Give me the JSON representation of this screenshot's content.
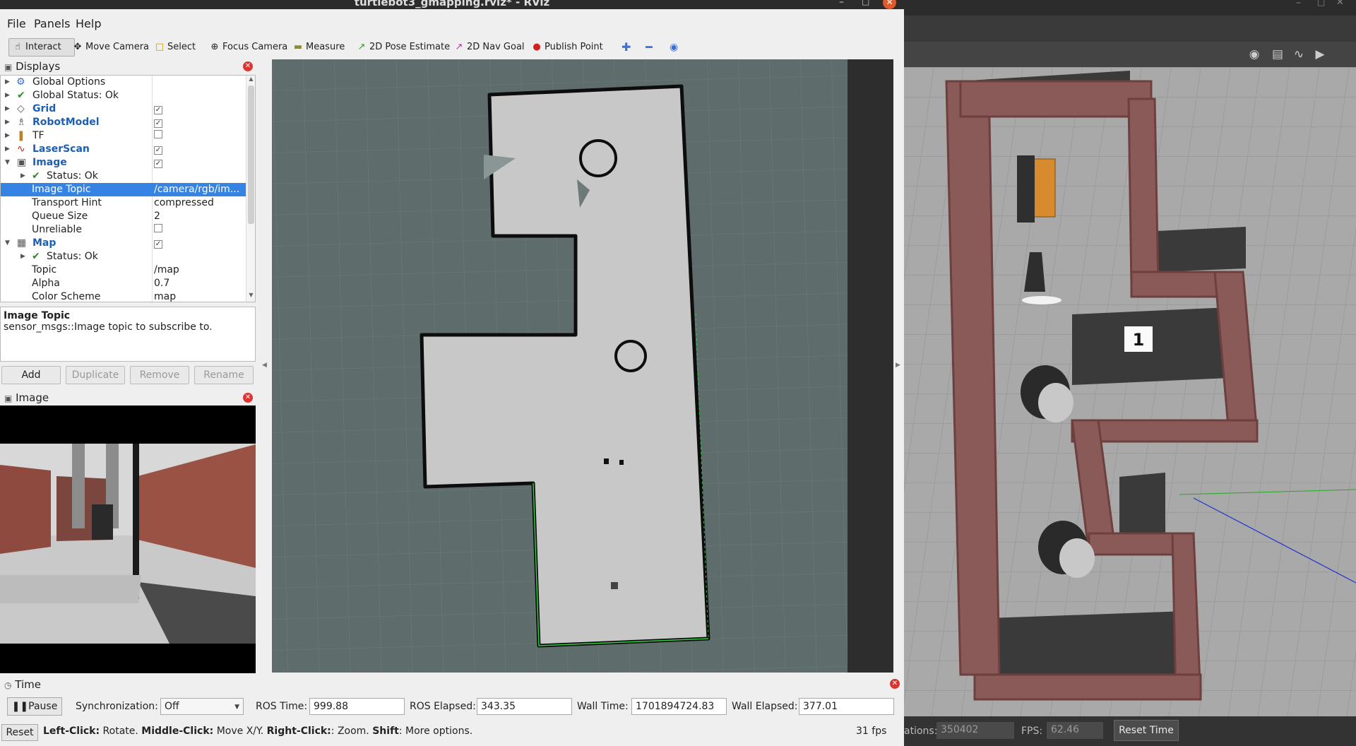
{
  "window": {
    "title": "turtlebot3_gmapping.rviz* - RViz"
  },
  "menu": [
    "File",
    "Panels",
    "Help"
  ],
  "toolbar": {
    "interact": "Interact",
    "move_camera": "Move Camera",
    "select": "Select",
    "focus_camera": "Focus Camera",
    "measure": "Measure",
    "pose_estimate": "2D Pose Estimate",
    "nav_goal": "2D Nav Goal",
    "publish_point": "Publish Point"
  },
  "displays": {
    "title": "Displays",
    "rows": [
      {
        "label": "Global Options",
        "value": ""
      },
      {
        "label": "Global Status: Ok",
        "value": ""
      },
      {
        "label": "Grid",
        "value": "checked"
      },
      {
        "label": "RobotModel",
        "value": "checked"
      },
      {
        "label": "TF",
        "value": "unchecked"
      },
      {
        "label": "LaserScan",
        "value": "checked"
      },
      {
        "label": "Image",
        "value": "checked"
      },
      {
        "label": "Status: Ok",
        "value": ""
      },
      {
        "label": "Image Topic",
        "value": "/camera/rgb/im..."
      },
      {
        "label": "Transport Hint",
        "value": "compressed"
      },
      {
        "label": "Queue Size",
        "value": "2"
      },
      {
        "label": "Unreliable",
        "value": "unchecked"
      },
      {
        "label": "Map",
        "value": "checked"
      },
      {
        "label": "Status: Ok",
        "value": ""
      },
      {
        "label": "Topic",
        "value": "/map"
      },
      {
        "label": "Alpha",
        "value": "0.7"
      },
      {
        "label": "Color Scheme",
        "value": "map"
      }
    ],
    "description_title": "Image Topic",
    "description_text": "sensor_msgs::Image topic to subscribe to.",
    "buttons": {
      "add": "Add",
      "duplicate": "Duplicate",
      "remove": "Remove",
      "rename": "Rename"
    }
  },
  "image_panel": {
    "title": "Image"
  },
  "time_panel": {
    "title": "Time",
    "pause": "Pause",
    "sync_label": "Synchronization:",
    "sync_value": "Off",
    "ros_time_label": "ROS Time:",
    "ros_time": "999.88",
    "ros_elapsed_label": "ROS Elapsed:",
    "ros_elapsed": "343.35",
    "wall_time_label": "Wall Time:",
    "wall_time": "1701894724.83",
    "wall_elapsed_label": "Wall Elapsed:",
    "wall_elapsed": "377.01"
  },
  "status": {
    "reset": "Reset",
    "left_click": "Left-Click:",
    "left_click_desc": " Rotate. ",
    "middle_click": "Middle-Click:",
    "middle_click_desc": " Move X/Y. ",
    "right_click": "Right-Click:",
    "right_click_desc": ": Zoom. ",
    "shift": "Shift",
    "shift_desc": ": More options.",
    "fps": "31 fps"
  },
  "gazebo": {
    "iterations_label": "ations:",
    "iterations": "350402",
    "fps_label": "FPS:",
    "fps": "62.46",
    "reset_time": "Reset Time",
    "marker_number": "1"
  }
}
